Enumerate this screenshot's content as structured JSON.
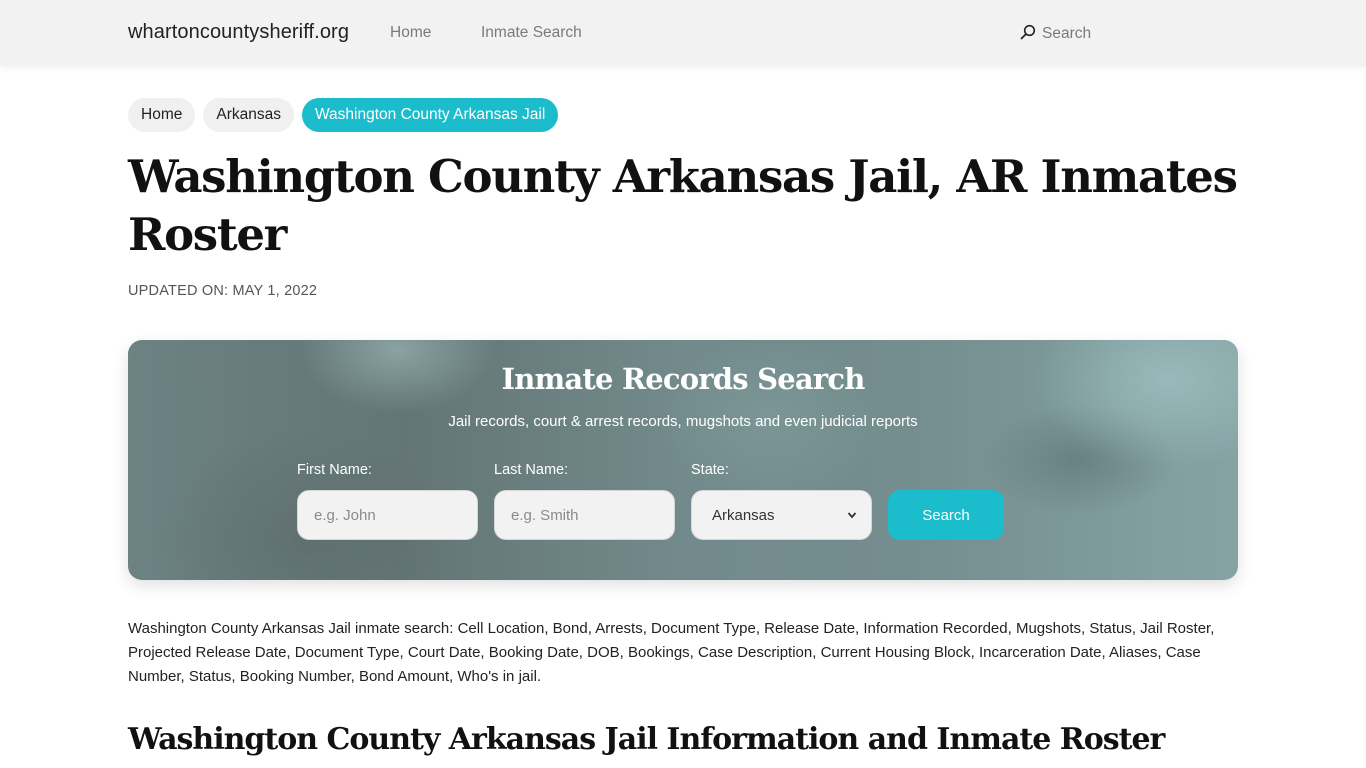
{
  "header": {
    "brand": "whartoncountysheriff.org",
    "nav": [
      {
        "label": "Home"
      },
      {
        "label": "Inmate Search"
      }
    ],
    "search_label": "Search",
    "search_icon": "search-icon"
  },
  "breadcrumb": [
    {
      "label": "Home",
      "active": false
    },
    {
      "label": "Arkansas",
      "active": false
    },
    {
      "label": "Washington County Arkansas Jail",
      "active": true
    }
  ],
  "page": {
    "title": "Washington County Arkansas Jail, AR Inmates Roster",
    "updated": "UPDATED ON: MAY 1, 2022"
  },
  "search_card": {
    "title": "Inmate Records Search",
    "subtitle": "Jail records, court & arrest records, mugshots and even judicial reports",
    "first_name": {
      "label": "First Name:",
      "placeholder": "e.g. John",
      "value": ""
    },
    "last_name": {
      "label": "Last Name:",
      "placeholder": "e.g. Smith",
      "value": ""
    },
    "state": {
      "label": "State:",
      "selected": "Arkansas"
    },
    "button_label": "Search"
  },
  "colors": {
    "accent": "#1bbccc",
    "header_bg": "#f2f2f2"
  },
  "description": "Washington County Arkansas Jail inmate search: Cell Location, Bond, Arrests, Document Type, Release Date, Information Recorded, Mugshots, Status, Jail Roster, Projected Release Date, Document Type, Court Date, Booking Date, DOB, Bookings, Case Description, Current Housing Block, Incarceration Date, Aliases, Case Number, Status, Booking Number, Bond Amount, Who's in jail.",
  "section": {
    "title": "Washington County Arkansas Jail Information and Inmate Roster"
  }
}
